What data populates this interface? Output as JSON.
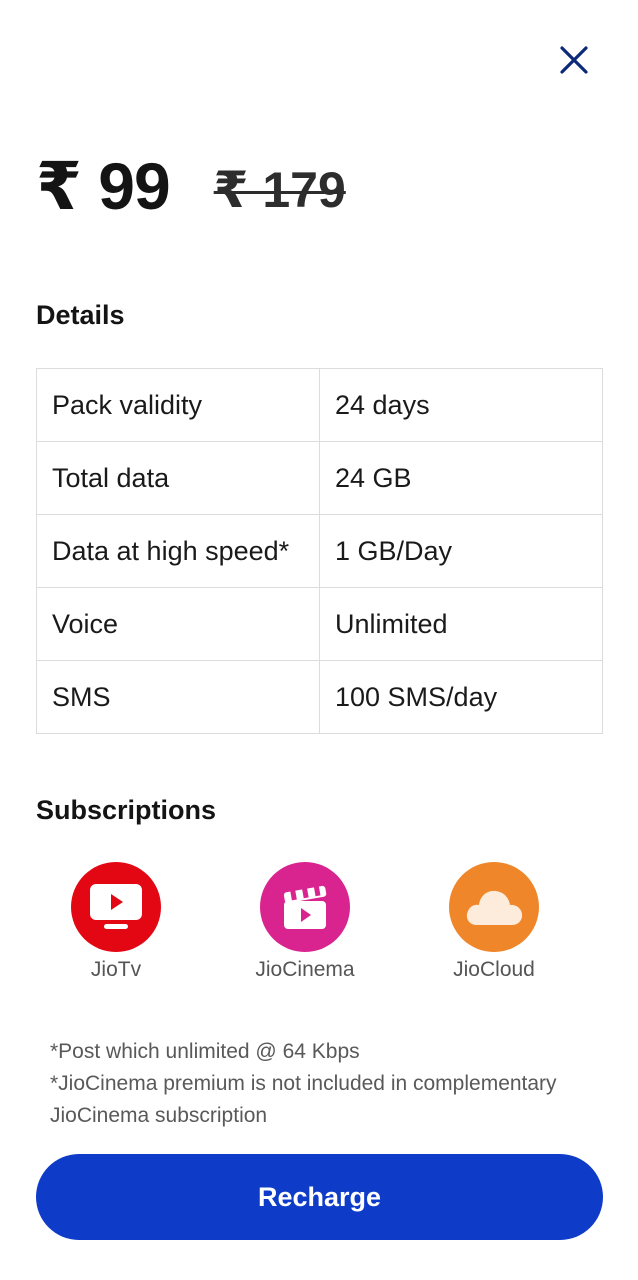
{
  "colors": {
    "accent": "#0e3cc9",
    "close_icon": "#0d2a7a",
    "jiotv": "#e30613",
    "jiocinema": "#d9248f",
    "jiocloud": "#f0862a"
  },
  "close_icon": "close-icon",
  "price": {
    "current": "₹ 99",
    "original": "₹ 179"
  },
  "details": {
    "title": "Details",
    "rows": [
      {
        "label": "Pack validity",
        "value": "24 days"
      },
      {
        "label": "Total data",
        "value": "24 GB"
      },
      {
        "label": "Data at high speed*",
        "value": "1 GB/Day"
      },
      {
        "label": "Voice",
        "value": "Unlimited"
      },
      {
        "label": "SMS",
        "value": "100 SMS/day"
      }
    ]
  },
  "subscriptions": {
    "title": "Subscriptions",
    "items": [
      {
        "name": "JioTv",
        "icon": "jiotv-icon"
      },
      {
        "name": "JioCinema",
        "icon": "jiocinema-icon"
      },
      {
        "name": "JioCloud",
        "icon": "jiocloud-icon"
      }
    ]
  },
  "notes": [
    "*Post which unlimited @ 64 Kbps",
    "*JioCinema premium is not included in complementary",
    "JioCinema subscription"
  ],
  "recharge_label": "Recharge"
}
